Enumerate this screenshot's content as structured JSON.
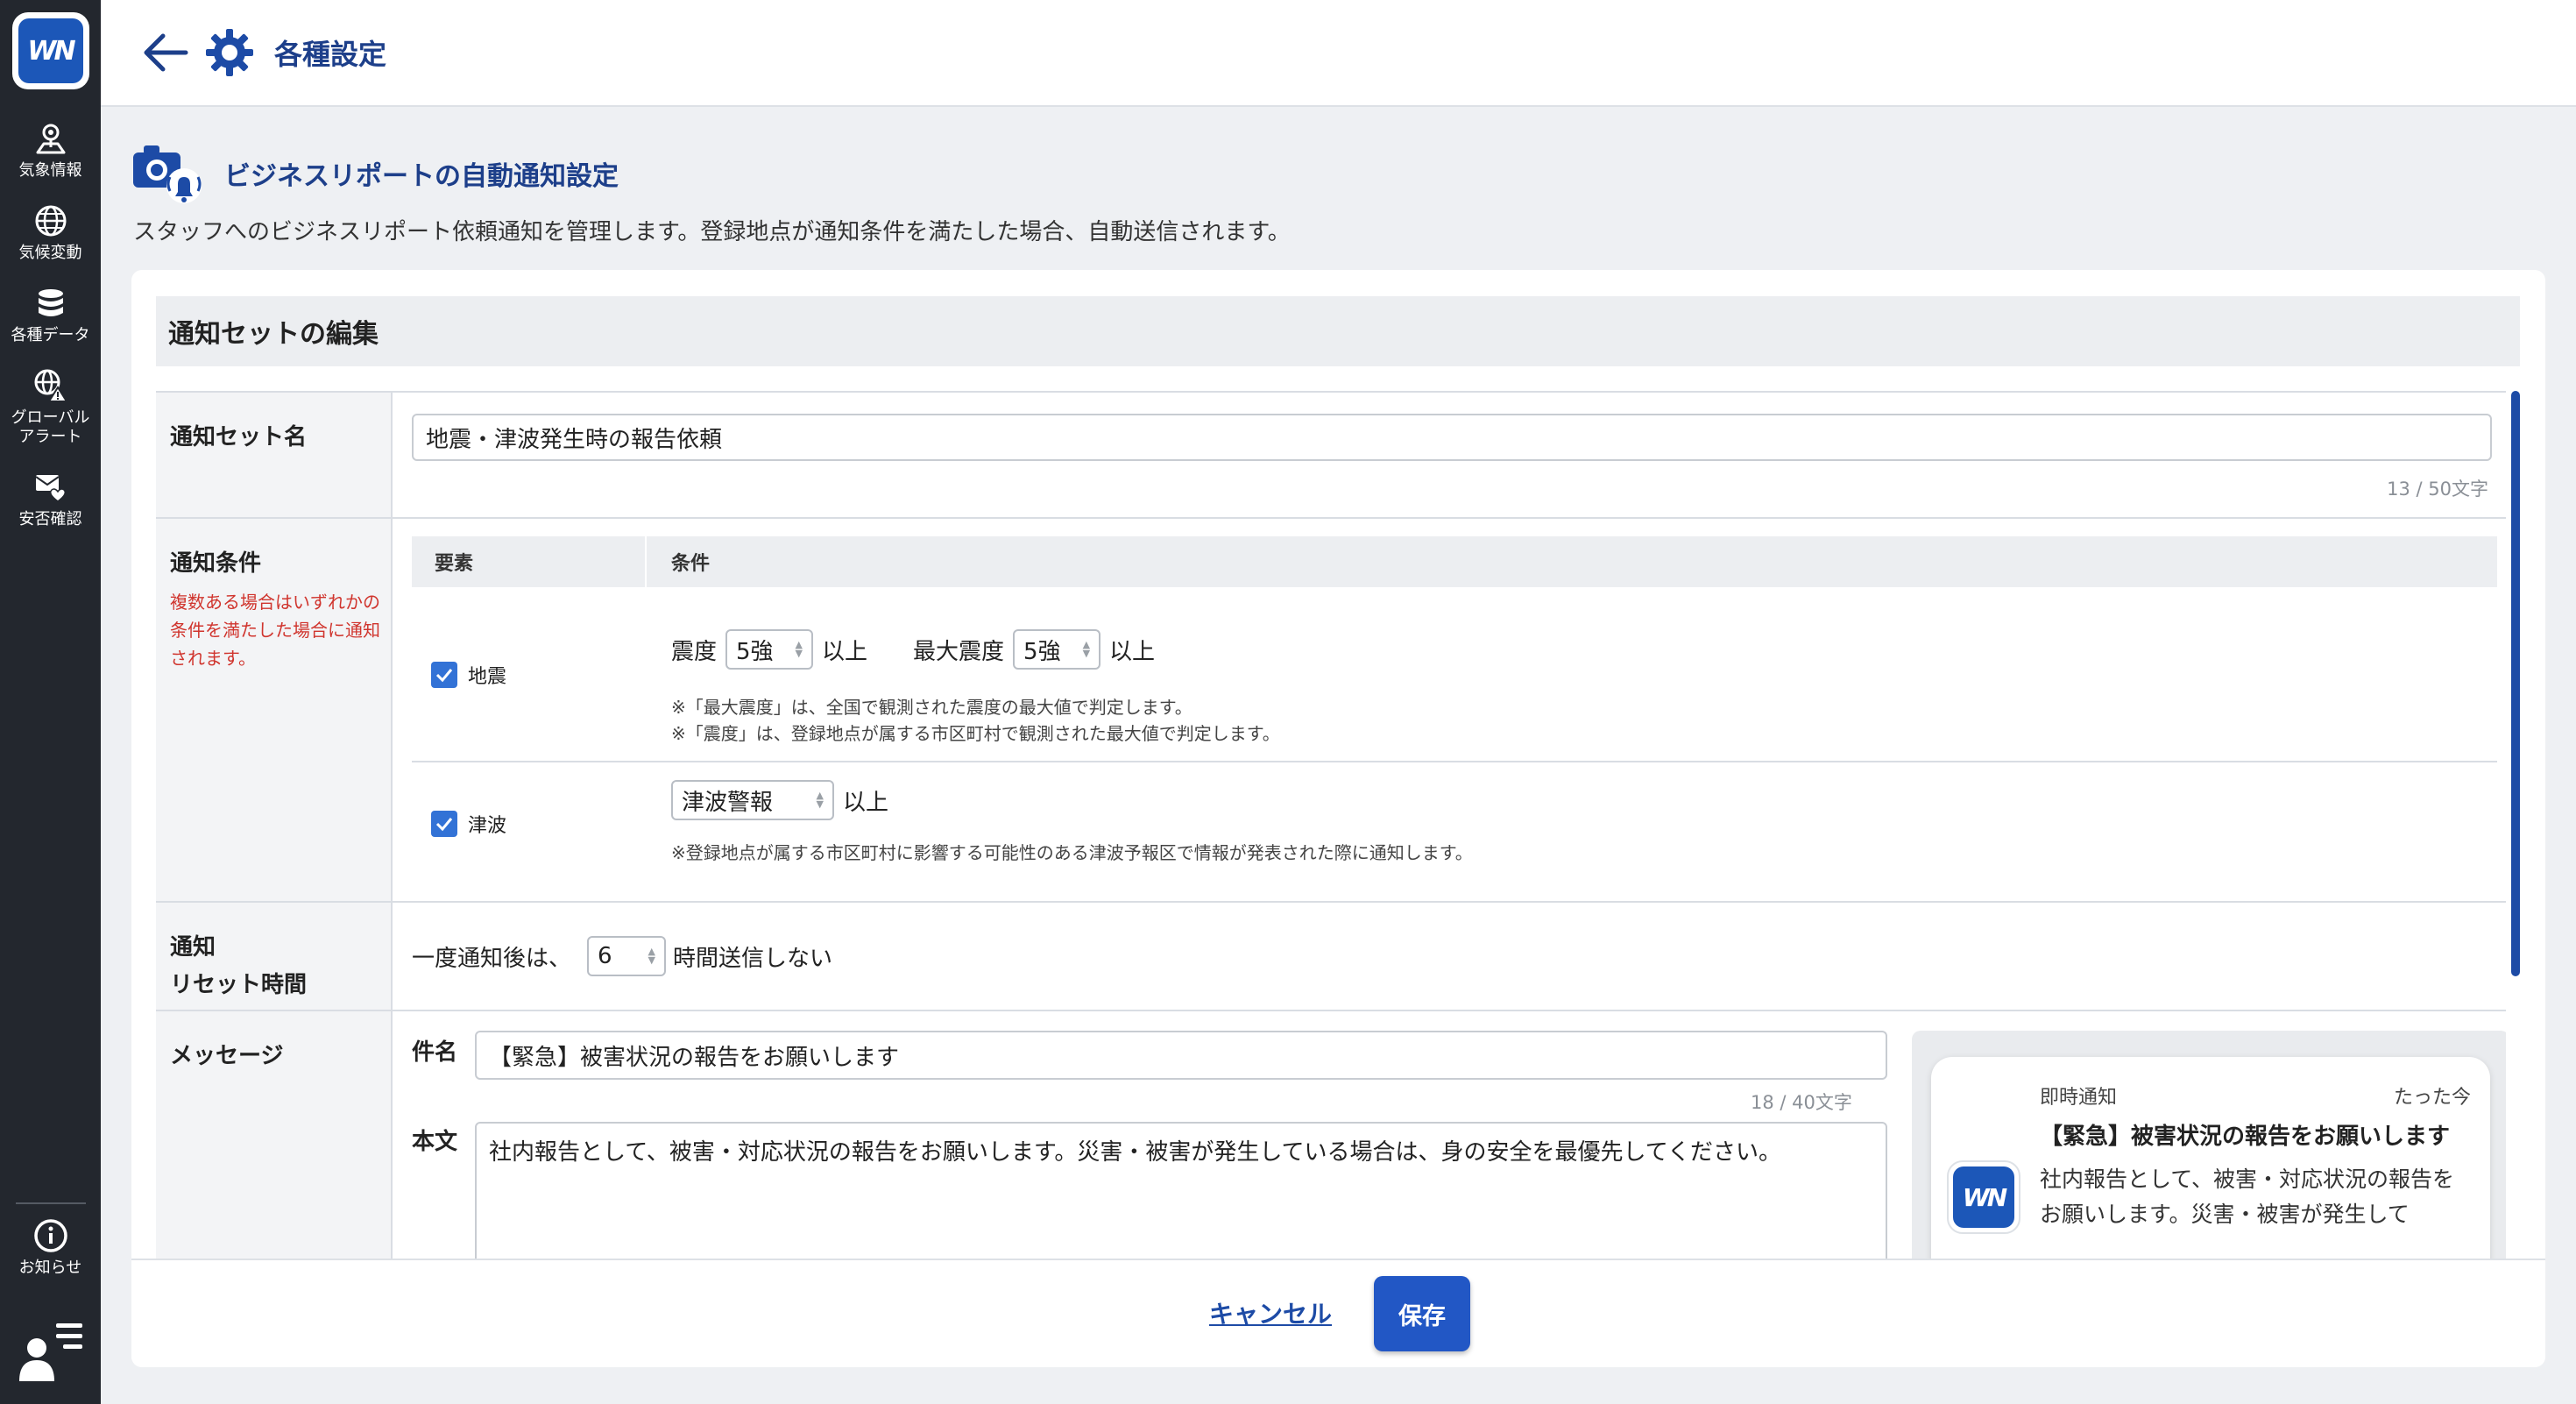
{
  "app": {
    "logo_text": "WN",
    "header_title": "各種設定"
  },
  "sidebar": {
    "items": [
      {
        "label": "気象情報",
        "icon": "map-pin-icon"
      },
      {
        "label": "気候変動",
        "icon": "globe-icon"
      },
      {
        "label": "各種データ",
        "icon": "database-icon"
      },
      {
        "label": "グローバル\nアラート",
        "icon": "globe-alert-icon"
      },
      {
        "label": "安否確認",
        "icon": "mail-heart-icon"
      }
    ],
    "notice_label": "お知らせ"
  },
  "page": {
    "title": "ビジネスリポートの自動通知設定",
    "description": "スタッフへのビジネスリポート依頼通知を管理します。登録地点が通知条件を満たした場合、自動送信されます。"
  },
  "form": {
    "section_title": "通知セットの編集",
    "name_label": "通知セット名",
    "name_value": "地震・津波発生時の報告依頼",
    "name_counter": "13 / 50文字",
    "cond_label": "通知条件",
    "cond_hint": "複数ある場合はいずれかの条件を満たした場合に通知されます。",
    "cond_headers": {
      "element": "要素",
      "condition": "条件"
    },
    "earthquake": {
      "label": "地震",
      "checked": true,
      "intensity_label": "震度",
      "intensity_value": "5強",
      "above": "以上",
      "max_label": "最大震度",
      "max_value": "5強",
      "note1": "※「最大震度」は、全国で観測された震度の最大値で判定します。",
      "note2": "※「震度」は、登録地点が属する市区町村で観測された最大値で判定します。"
    },
    "tsunami": {
      "label": "津波",
      "checked": true,
      "level_value": "津波警報",
      "above": "以上",
      "note": "※登録地点が属する市区町村に影響する可能性のある津波予報区で情報が発表された際に通知します。"
    },
    "reset_label_1": "通知",
    "reset_label_2": "リセット時間",
    "reset_prefix": "一度通知後は、",
    "reset_value": "6",
    "reset_suffix": "時間送信しない",
    "message_label": "メッセージ",
    "subject_label": "件名",
    "subject_value": "【緊急】被害状況の報告をお願いします",
    "subject_counter": "18 / 40文字",
    "body_label": "本文",
    "body_value": "社内報告として、被害・対応状況の報告をお願いします。災害・被害が発生している場合は、身の安全を最優先してください。"
  },
  "preview": {
    "type_label": "即時通知",
    "time_label": "たった今",
    "title": "【緊急】被害状況の報告をお願いします",
    "body": "社内報告として、被害・対応状況の報告をお願いします。災害・被害が発生して"
  },
  "buttons": {
    "cancel": "キャンセル",
    "save": "保存"
  },
  "colors": {
    "sidebar_bg": "#23272e",
    "accent": "#2257c5",
    "title_blue": "#1d3f8a",
    "hint_red": "#d0352e"
  }
}
